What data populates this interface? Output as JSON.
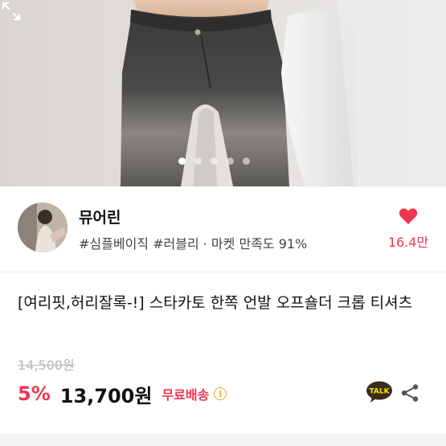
{
  "gallery": {
    "dot_count": 5,
    "active_index": 0,
    "expand_icon": "expand-icon"
  },
  "seller": {
    "name": "뮤어린",
    "tags": "#심플베이직 #러블리 · 마켓 만족도 91%",
    "likes": "16.4만",
    "like_color": "#f0364f"
  },
  "product": {
    "title": "[여리핏,허리잘록-!] 스타카토 한쪽 언발 오프숄더 크롭 티셔츠",
    "original_price": "14,500원",
    "discount": "5%",
    "price": "13,700원",
    "shipping": "무료배송",
    "talk_label": "TALK"
  },
  "colors": {
    "accent": "#f0364f",
    "talk_bg": "#3c2a1e",
    "talk_fill": "#f7e600"
  }
}
